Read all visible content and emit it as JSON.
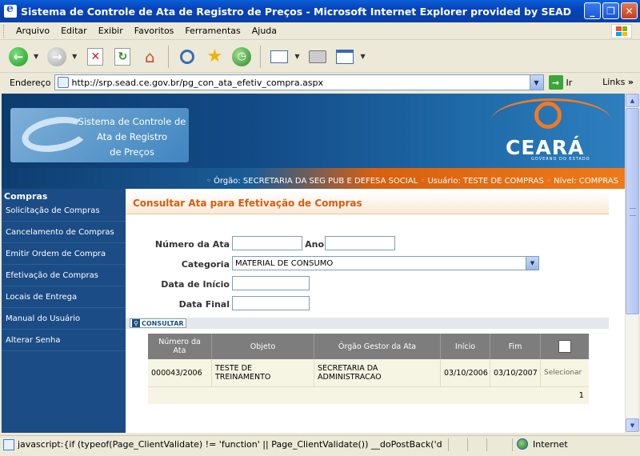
{
  "window": {
    "title": "Sistema de Controle de Ata de Registro de Preços - Microsoft Internet Explorer provided by SEAD",
    "minimize": "_",
    "maximize": "❐",
    "close": "✕"
  },
  "menu": [
    "Arquivo",
    "Editar",
    "Exibir",
    "Favoritos",
    "Ferramentas",
    "Ajuda"
  ],
  "toolbar": {
    "icons": [
      "back-icon",
      "forward-icon",
      "stop-icon",
      "refresh-icon",
      "home-icon",
      "search-icon",
      "favorites-icon",
      "history-icon",
      "mail-icon",
      "print-icon",
      "edit-icon"
    ]
  },
  "address": {
    "label": "Endereço",
    "url": "http://srp.sead.ce.gov.br/pg_con_ata_efetiv_compra.aspx",
    "go_label": "Ir",
    "links_label": "Links"
  },
  "header": {
    "logo_line1": "Sistema de Controle de",
    "logo_line2": "Ata de Registro",
    "logo_line3": "de Preços",
    "brand": "CEARÁ",
    "brand_sub": "GOVERNO DO ESTADO",
    "info_orgao": "Órgão: SECRETARIA DA SEG PUB E DEFESA SOCIAL",
    "info_usuario": "Usuário: TESTE DE COMPRAS",
    "info_nivel": "Nível: COMPRAS"
  },
  "sidebar": {
    "title": "Compras",
    "items": [
      {
        "label": "Solicitação de Compras"
      },
      {
        "label": "Cancelamento de Compras"
      },
      {
        "label": "Emitir Ordem de Compra"
      },
      {
        "label": "Efetivação de Compras"
      },
      {
        "label": "Locais de Entrega"
      },
      {
        "label": "Manual do Usuário"
      },
      {
        "label": "Alterar Senha"
      }
    ]
  },
  "page": {
    "title": "Consultar Ata para Efetivação de Compras"
  },
  "form": {
    "numero_ata_label": "Número da Ata",
    "numero_ata_value": "",
    "ano_label": "Ano",
    "ano_value": "",
    "categoria_label": "Categoria",
    "categoria_value": "MATERIAL DE CONSUMO",
    "data_inicio_label": "Data de Início",
    "data_inicio_value": "",
    "data_final_label": "Data Final",
    "data_final_value": "",
    "consultar_label": "CONSULTAR"
  },
  "grid": {
    "headers": {
      "numero_line1": "Número da",
      "numero_line2": "Ata",
      "objeto": "Objeto",
      "orgao": "Órgão Gestor da Ata",
      "inicio": "Início",
      "fim": "Fim"
    },
    "rows": [
      {
        "numero": "000043/2006",
        "objeto_line1": "TESTE DE",
        "objeto_line2": "TREINAMENTO",
        "orgao_line1": "SECRETARIA DA",
        "orgao_line2": "ADMINISTRACAO",
        "inicio": "03/10/2006",
        "fim": "03/10/2007",
        "action": "Selecionar"
      }
    ],
    "page": "1"
  },
  "status": {
    "text": "javascript:{if (typeof(Page_ClientValidate) != 'function' ||  Page_ClientValidate()) __doPostBack('dgAta$",
    "zone": "Internet"
  }
}
